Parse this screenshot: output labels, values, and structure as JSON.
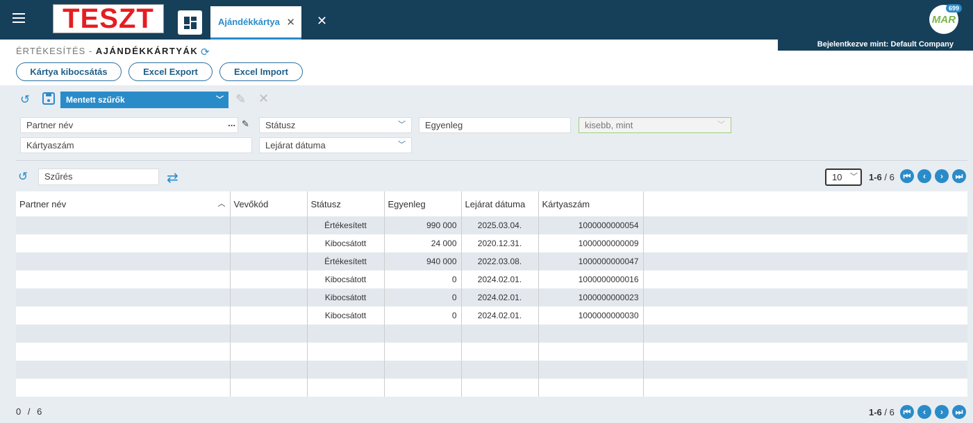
{
  "topbar": {
    "logo_text": "TESZT",
    "tab_label": "Ajándékkártya",
    "tab_close": "✕",
    "close_all": "✕",
    "avatar_text": "MAR",
    "badge": "699"
  },
  "login": {
    "prefix": "Bejelentkezve mint: ",
    "company": "Default Company"
  },
  "breadcrumb": {
    "section": "ÉRTÉKESÍTÉS - ",
    "page": "AJÁNDÉKKÁRTYÁK"
  },
  "actions": {
    "issue": "Kártya kibocsátás",
    "export": "Excel Export",
    "import": "Excel Import"
  },
  "filters": {
    "saved_filters": "Mentett szűrők",
    "partner": "Partner név",
    "partner_dots": "...",
    "status": "Státusz",
    "balance": "Egyenleg",
    "balance_op": "kisebb, mint",
    "card_no": "Kártyaszám",
    "expiry": "Lejárat dátuma"
  },
  "grid": {
    "filter_placeholder": "Szűrés",
    "page_size": "10",
    "page_range": "1-6",
    "page_total": " / 6",
    "columns": [
      "Partner név",
      "Vevőkód",
      "Státusz",
      "Egyenleg",
      "Lejárat dátuma",
      "Kártyaszám",
      ""
    ],
    "rows": [
      [
        "",
        "",
        "Értékesített",
        "990 000",
        "2025.03.04.",
        "1000000000054"
      ],
      [
        "",
        "",
        "Kibocsátott",
        "24 000",
        "2020.12.31.",
        "1000000000009"
      ],
      [
        "",
        "",
        "Értékesített",
        "940 000",
        "2022.03.08.",
        "1000000000047"
      ],
      [
        "",
        "",
        "Kibocsátott",
        "0",
        "2024.02.01.",
        "1000000000016"
      ],
      [
        "",
        "",
        "Kibocsátott",
        "0",
        "2024.02.01.",
        "1000000000023"
      ],
      [
        "",
        "",
        "Kibocsátott",
        "0",
        "2024.02.01.",
        "1000000000030"
      ]
    ],
    "empty_rows": 4,
    "footer_selected": "0 / 6"
  },
  "colors": {
    "topbar": "#163f5a",
    "accent": "#2a8bc9",
    "logo_red": "#e41e22"
  }
}
